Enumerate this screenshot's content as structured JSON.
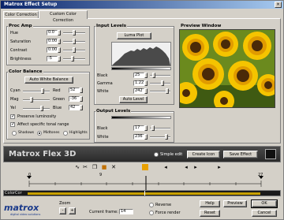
{
  "window": {
    "title": "Matrox Effect Setup",
    "close_glyph": "×"
  },
  "tabs": [
    {
      "label": "Color Correction"
    },
    {
      "label": "Custom Color Correction"
    }
  ],
  "proc_amp": {
    "title": "Proc Amp",
    "rows": [
      {
        "label": "Hue",
        "value": "0.0",
        "level": 0.5
      },
      {
        "label": "Saturation",
        "value": "0.00",
        "level": 0.5
      },
      {
        "label": "Contrast",
        "value": "0.00",
        "level": 0.5
      },
      {
        "label": "Brightness",
        "value": "-5",
        "level": 0.45
      }
    ]
  },
  "color_balance": {
    "title": "Color Balance",
    "auto_button": "Auto White Balance",
    "rows": [
      {
        "left": "Cyan",
        "right": "Red",
        "value": "52"
      },
      {
        "left": "Mag",
        "right": "Green",
        "value": "-36"
      },
      {
        "left": "Yel",
        "right": "Blue",
        "value": "42"
      }
    ],
    "preserve_luminosity": "Preserve luminosity",
    "affect_range": "Affect specific tonal range",
    "ranges": [
      "Shadows",
      "Midtones",
      "Highlights"
    ]
  },
  "input_levels": {
    "title": "Input Levels",
    "luma_plot": "Luma Plot",
    "rows": [
      {
        "label": "Black",
        "value": "25"
      },
      {
        "label": "Gamma",
        "value": "1.22"
      },
      {
        "label": "White",
        "value": "242"
      }
    ],
    "auto_level": "Auto Level"
  },
  "output_levels": {
    "title": "Output Levels",
    "rows": [
      {
        "label": "Black",
        "value": "17"
      },
      {
        "label": "White",
        "value": "236"
      }
    ]
  },
  "preview": {
    "title": "Preview Window"
  },
  "banner": {
    "product": "Matrox Flex 3D",
    "simple_edit": "Simple edit",
    "create_icon": "Create Icon",
    "save_effect": "Save Effect"
  },
  "ruler": {
    "start": "0",
    "mid": "9",
    "end": "27"
  },
  "timeline": {
    "label": "ColorCor"
  },
  "bottom": {
    "logo": "matrox",
    "logo_sub": "digital video solutions",
    "zoom_label": "Zoom",
    "zoom_minus": "-",
    "zoom_plus": "+",
    "current_frame_label": "Current frame:",
    "current_frame_value": "14",
    "reverse": "Reverse",
    "force_render": "Force render",
    "help": "Help",
    "preview": "Preview",
    "ok": "OK",
    "reset": "Reset",
    "cancel": "Cancel"
  }
}
